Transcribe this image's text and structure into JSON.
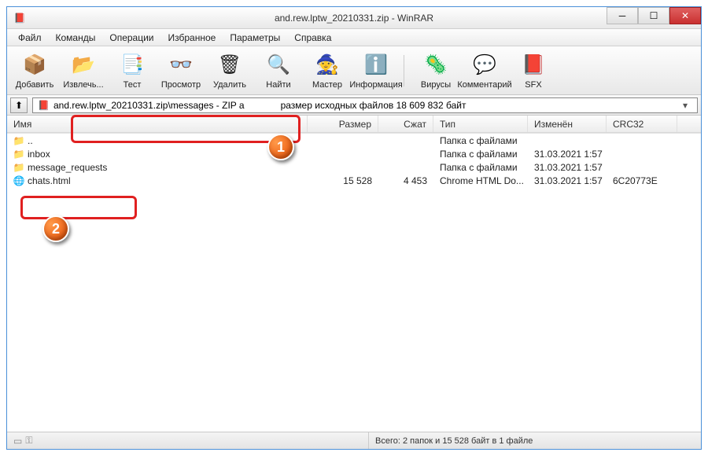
{
  "titlebar": {
    "title": "and.rew.lptw_20210331.zip - WinRAR"
  },
  "menubar": {
    "items": [
      "Файл",
      "Команды",
      "Операции",
      "Избранное",
      "Параметры",
      "Справка"
    ]
  },
  "toolbar": {
    "buttons": [
      {
        "icon": "📦",
        "label": "Добавить"
      },
      {
        "icon": "📂",
        "label": "Извлечь..."
      },
      {
        "icon": "📑",
        "label": "Тест"
      },
      {
        "icon": "👓",
        "label": "Просмотр"
      },
      {
        "icon": "🗑",
        "label": "Удалить"
      },
      {
        "icon": "🔍",
        "label": "Найти"
      },
      {
        "icon": "🧙",
        "label": "Мастер"
      },
      {
        "icon": "ℹ️",
        "label": "Информация"
      },
      {
        "icon": "🦠",
        "label": "Вирусы"
      },
      {
        "icon": "💬",
        "label": "Комментарий"
      },
      {
        "icon": "📕",
        "label": "SFX"
      }
    ]
  },
  "pathbar": {
    "text": "and.rew.lptw_20210331.zip\\messages - ZIP а",
    "tail": "размер исходных файлов 18 609 832 байт"
  },
  "columns": {
    "name": "Имя",
    "size": "Размер",
    "packed": "Сжат",
    "type": "Тип",
    "modified": "Изменён",
    "crc": "CRC32"
  },
  "rows": [
    {
      "icon": "📁",
      "name": "..",
      "size": "",
      "packed": "",
      "type": "Папка с файлами",
      "modified": "",
      "crc": ""
    },
    {
      "icon": "📁",
      "name": "inbox",
      "size": "",
      "packed": "",
      "type": "Папка с файлами",
      "modified": "31.03.2021 1:57",
      "crc": ""
    },
    {
      "icon": "📁",
      "name": "message_requests",
      "size": "",
      "packed": "",
      "type": "Папка с файлами",
      "modified": "31.03.2021 1:57",
      "crc": ""
    },
    {
      "icon": "🌐",
      "name": "chats.html",
      "size": "15 528",
      "packed": "4 453",
      "type": "Chrome HTML Do...",
      "modified": "31.03.2021 1:57",
      "crc": "6C20773E"
    }
  ],
  "statusbar": {
    "right": "Всего: 2 папок и 15 528 байт в 1 файле"
  },
  "callouts": [
    "1",
    "2"
  ]
}
